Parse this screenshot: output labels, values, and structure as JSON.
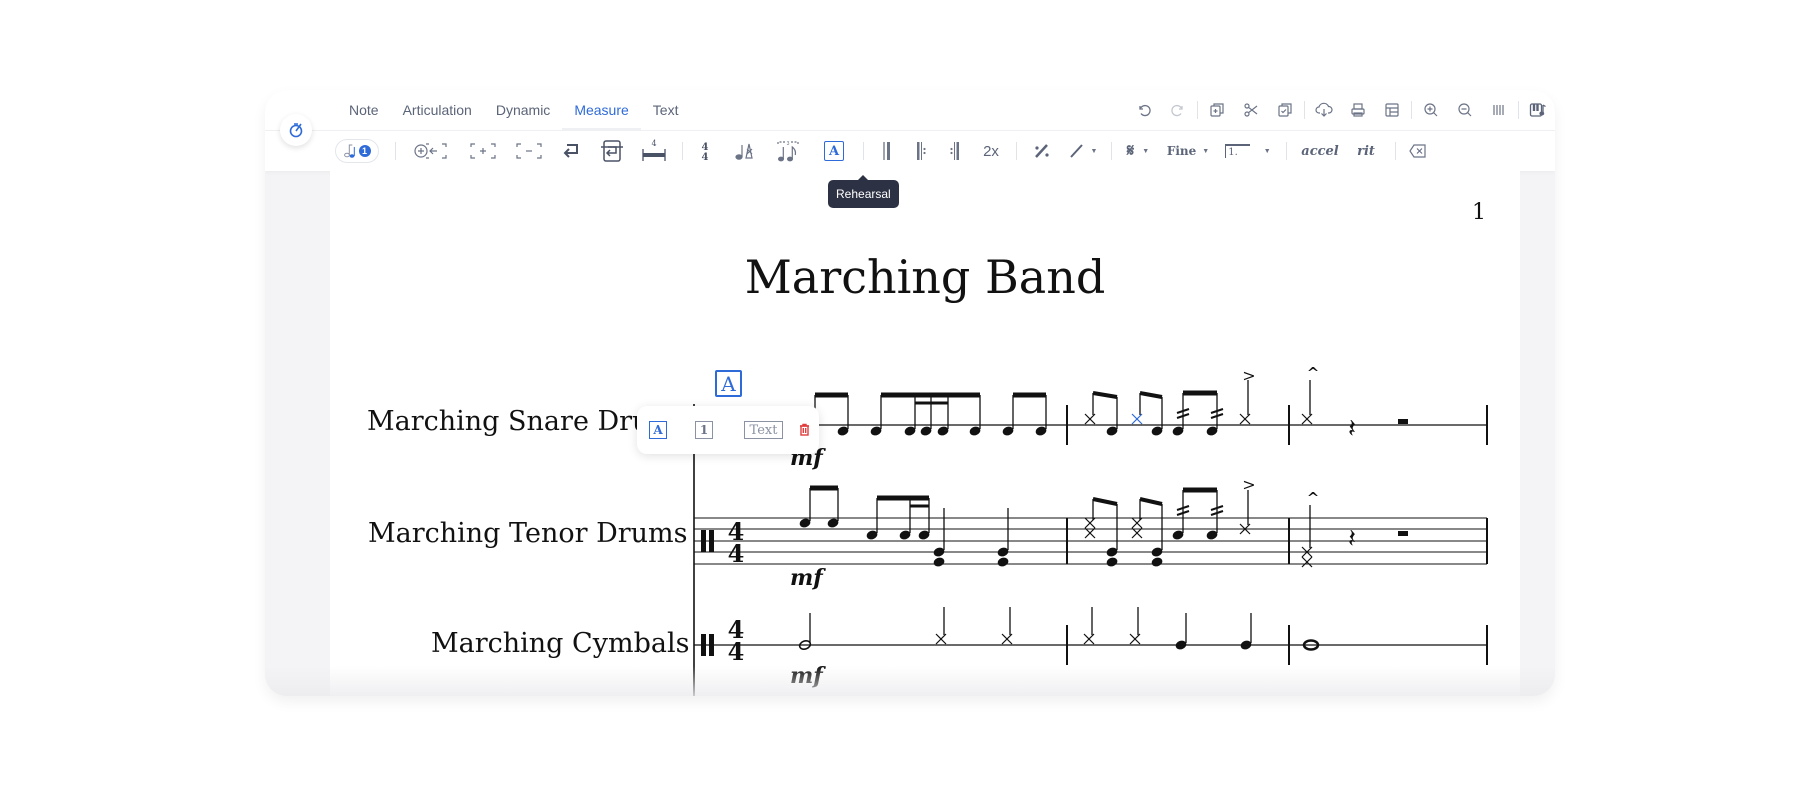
{
  "tabs": [
    {
      "label": "Note",
      "active": false
    },
    {
      "label": "Articulation",
      "active": false
    },
    {
      "label": "Dynamic",
      "active": false
    },
    {
      "label": "Measure",
      "active": true
    },
    {
      "label": "Text",
      "active": false
    }
  ],
  "top_icons": [
    "undo-icon",
    "redo-icon",
    "duplicate-icon",
    "cut-icon",
    "paste-icon",
    "cloud-download-icon",
    "print-icon",
    "layout-icon",
    "zoom-in-icon",
    "zoom-out-icon",
    "barlines-view-icon",
    "piano-roll-icon"
  ],
  "toolbar": {
    "voice_badge": "1",
    "repeat_label": "2x",
    "fine_label": "Fine",
    "volta_label": "1.",
    "accel_label": "accel",
    "rit_label": "rit",
    "time_sig_num": "4",
    "multirest_count": "4"
  },
  "tooltip": "Rehearsal",
  "score": {
    "page_number": "1",
    "title": "Marching Band",
    "instruments": [
      "Marching Snare Drums",
      "Marching Tenor Drums",
      "Marching Cymbals"
    ],
    "dynamic": "mf",
    "time_signature": "4/4",
    "rehearsal_mark": "A"
  },
  "popup": {
    "letter_label": "A",
    "number_label": "1",
    "text_label": "Text"
  },
  "colors": {
    "accent": "#2f6bd8",
    "danger": "#e03c3c",
    "icon": "#5b6478"
  }
}
